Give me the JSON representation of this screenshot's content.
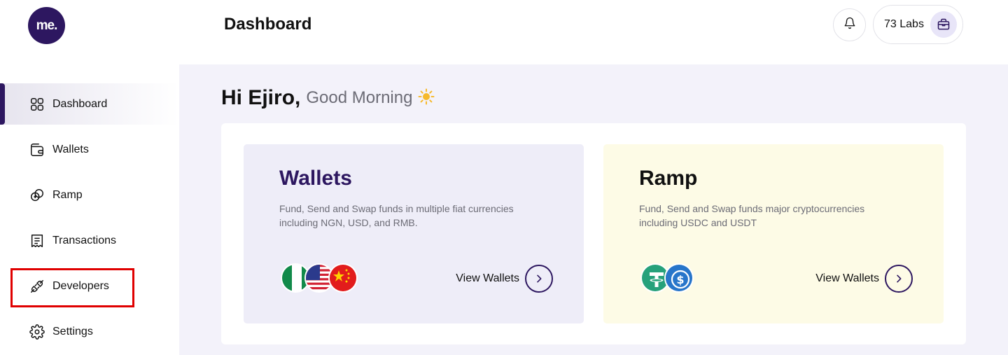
{
  "brand": {
    "logo_text": "me."
  },
  "header": {
    "title": "Dashboard",
    "org_name": "73 Labs"
  },
  "sidebar": {
    "items": [
      {
        "label": "Dashboard",
        "icon": "grid-icon",
        "active": true
      },
      {
        "label": "Wallets",
        "icon": "wallet-icon"
      },
      {
        "label": "Ramp",
        "icon": "coins-icon"
      },
      {
        "label": "Transactions",
        "icon": "receipt-icon"
      },
      {
        "label": "Developers",
        "icon": "plug-icon"
      },
      {
        "label": "Settings",
        "icon": "gear-icon"
      }
    ]
  },
  "greeting": {
    "name": "Hi Ejiro,",
    "message": "Good Morning",
    "emoji": "☀️"
  },
  "cards": {
    "wallets": {
      "title": "Wallets",
      "description": "Fund, Send and Swap funds in multiple fiat currencies including NGN, USD, and RMB.",
      "link": "View Wallets",
      "icons": [
        "nigeria-flag-icon",
        "usa-flag-icon",
        "china-flag-icon"
      ]
    },
    "ramp": {
      "title": "Ramp",
      "description": "Fund, Send and Swap funds major cryptocurrencies including USDC and USDT",
      "link": "View Wallets",
      "icons": [
        "tether-icon",
        "usdc-icon"
      ]
    }
  },
  "colors": {
    "brand": "#2d1760",
    "highlight": "#e00000",
    "main_bg": "#f3f2fa",
    "ramp_card": "#fdfbe6",
    "wallet_card": "#eeedf8"
  }
}
